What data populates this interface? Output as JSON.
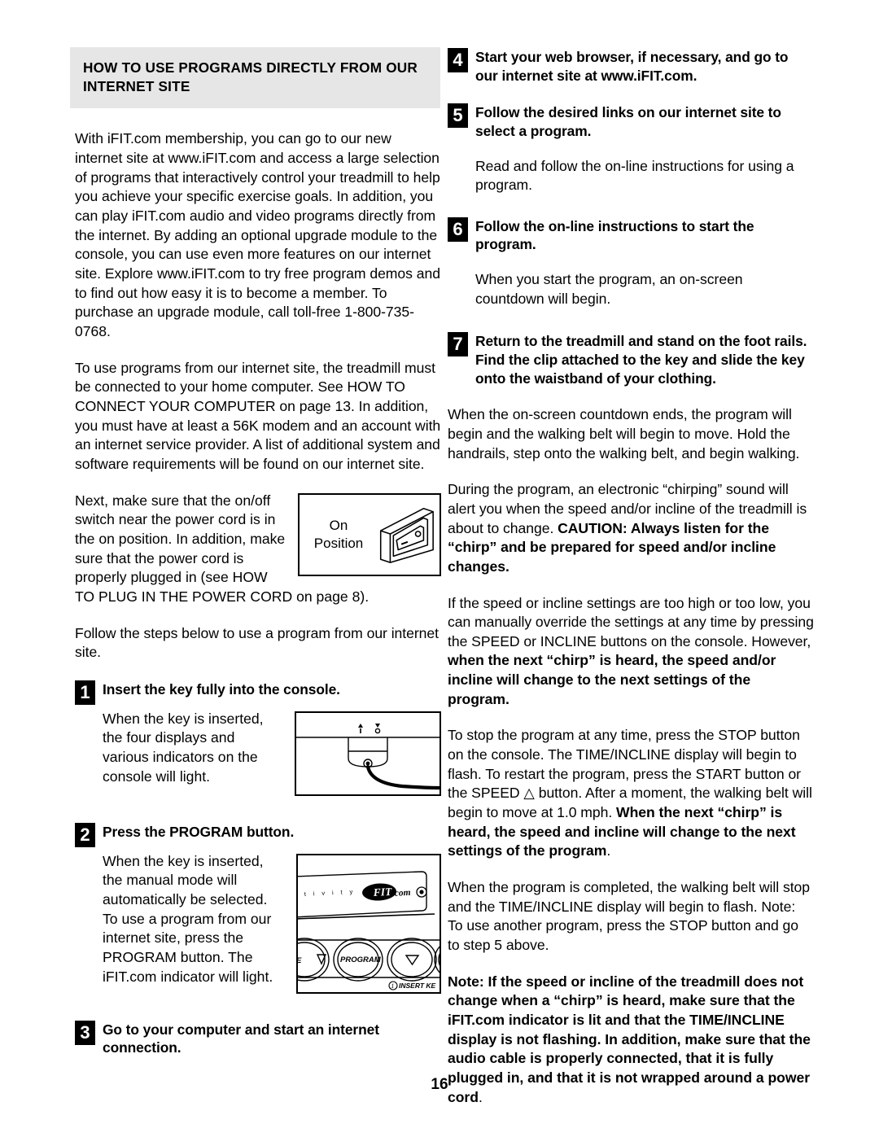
{
  "page": {
    "number": "16"
  },
  "left_column": {
    "section_header": "HOW TO USE PROGRAMS DIRECTLY FROM OUR INTERNET SITE",
    "intro_paragraph": "With iFIT.com membership, you can go to our new internet site at www.iFIT.com and access a large selection of programs that interactively control your treadmill to help you achieve your specific exercise goals. In addition, you can play iFIT.com audio and video programs directly from the internet. By adding an optional upgrade module to the console, you can use even more features on our internet site. Explore www.iFIT.com to try free program demos and to find out how easy it is to become a member. To purchase an upgrade module, call toll-free 1-800-735-0768.",
    "requirements_paragraph": "To use programs from our internet site, the treadmill must be connected to your home computer. See HOW TO CONNECT YOUR COMPUTER on page 13. In addition, you must have at least a 56K modem and an account with an internet service provider. A list of additional system and software requirements will be found on our internet site.",
    "switch_paragraph": "Next, make sure that the on/off switch near the power cord is in the on position. In addition, make sure that the power cord is properly plugged in (see HOW TO PLUG IN THE POWER CORD on page 8).",
    "switch_figure": {
      "label_line1": "On",
      "label_line2": "Position"
    },
    "follow_steps_paragraph": "Follow the steps below to use a program from our internet site.",
    "steps": [
      {
        "number": "1",
        "title": "Insert the key fully into the console.",
        "body": "When the key is inserted, the four displays and various indicators on the console will light."
      },
      {
        "number": "2",
        "title": "Press the PROGRAM button.",
        "body": "When the key is inserted, the manual mode will automatically be selected. To use a program from our internet site, press the PROGRAM button. The iFIT.com indicator will light."
      },
      {
        "number": "3",
        "title": "Go to your computer and start an internet connection.",
        "body": ""
      }
    ],
    "console_figure": {
      "brand_text": "iFIT.com",
      "activity_text": "t i v i t y",
      "button_incline": "E",
      "button_program": "PROGRAM",
      "insert_key_text": "INSERT KE"
    }
  },
  "right_column": {
    "steps": [
      {
        "number": "4",
        "title": "Start your web browser, if necessary, and go to our internet site at www.iFIT.com.",
        "body": ""
      },
      {
        "number": "5",
        "title": "Follow the desired links on our internet site to select a program.",
        "body": "Read and follow the on-line instructions for using a program."
      },
      {
        "number": "6",
        "title": "Follow the on-line instructions to start the program.",
        "body": "When you start the program, an on-screen countdown will begin."
      },
      {
        "number": "7",
        "title": "Return to the treadmill and stand on the foot rails. Find the clip attached to the key and slide the key onto the waistband of your clothing.",
        "body": ""
      }
    ],
    "paragraph_countdown": "When the on-screen countdown ends, the program will begin and the walking belt will begin to move. Hold the handrails, step onto the walking belt, and begin walking.",
    "paragraph_chirp_normal": "During the program, an electronic “chirping” sound will alert you when the speed and/or incline of the treadmill is about to change. ",
    "paragraph_chirp_bold": "CAUTION: Always listen for the “chirp” and be prepared for speed and/or incline changes.",
    "paragraph_override_normal": "If the speed or incline settings are too high or too low, you can manually override the settings at any time by pressing the SPEED or INCLINE buttons on the console. However, ",
    "paragraph_override_bold": "when the next “chirp” is heard, the speed and/or incline will change to the next settings of the program.",
    "paragraph_stop_normal_1": "To stop the program at any time, press the STOP button on the console. The TIME/INCLINE display will begin to flash. To restart the program, press the START button or the SPEED ",
    "paragraph_stop_triangle": "△",
    "paragraph_stop_normal_2": " button. After a moment, the walking belt will begin to move at 1.0 mph. ",
    "paragraph_stop_bold": "When the next “chirp” is heard, the speed and incline will change to the next settings of the program",
    "paragraph_stop_tail": ".",
    "paragraph_completed": "When the program is completed, the walking belt will stop and the TIME/INCLINE display will begin to flash. Note: To use another program, press the STOP button and go to step 5 above.",
    "paragraph_note_bold": "Note: If the speed or incline of the treadmill does not change when a “chirp” is heard, make sure that the iFIT.com indicator is lit and that the TIME/INCLINE display is not flashing. In addition, make sure that the audio cable is properly connected, that it is fully plugged in, and that it is not wrapped around a power cord",
    "paragraph_note_tail": "."
  },
  "colors": {
    "header_background": "#e6e6e6",
    "text": "#000000",
    "page_background": "#ffffff"
  }
}
